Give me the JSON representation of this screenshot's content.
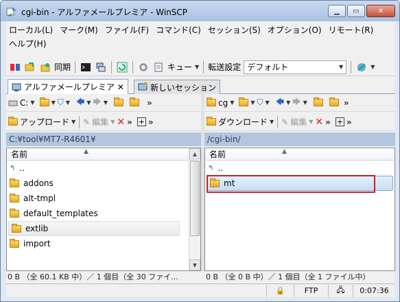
{
  "window": {
    "title": "cgi-bin - アルファメールプレミア - WinSCP"
  },
  "menu": {
    "row1": [
      "ローカル(L)",
      "マーク(M)",
      "ファイル(F)",
      "コマンド(C)",
      "セッション(S)",
      "オプション(O)",
      "リモート(R)"
    ],
    "row2": [
      "ヘルプ(H)"
    ]
  },
  "toolbar": {
    "sync_label": "同期",
    "queue_label": "キュー",
    "transfer_label": "転送設定",
    "transfer_value": "デフォルト"
  },
  "tabs": {
    "active_label": "アルファメールプレミア",
    "new_label": "新しいセッション"
  },
  "left": {
    "drive": "C:",
    "upload_label": "アップロード",
    "edit_label": "編集",
    "path": "C:¥tool¥MT7-R4601¥",
    "column_name": "名前",
    "rows": [
      "..",
      "addons",
      "alt-tmpl",
      "default_templates",
      "extlib",
      "import"
    ],
    "status": "0 B （全 60.1 KB 中）／ 1 個目（全 30 ファイ..."
  },
  "right": {
    "drive": "cg",
    "download_label": "ダウンロード",
    "edit_label": "編集",
    "path": "/cgi-bin/",
    "column_name": "名前",
    "rows": [
      "..",
      "mt"
    ],
    "status": "0 B （全 0 B 中）／ 1 個目（全 1 ファイル中）"
  },
  "statusbar": {
    "protocol": "FTP",
    "time": "0:07:36"
  }
}
